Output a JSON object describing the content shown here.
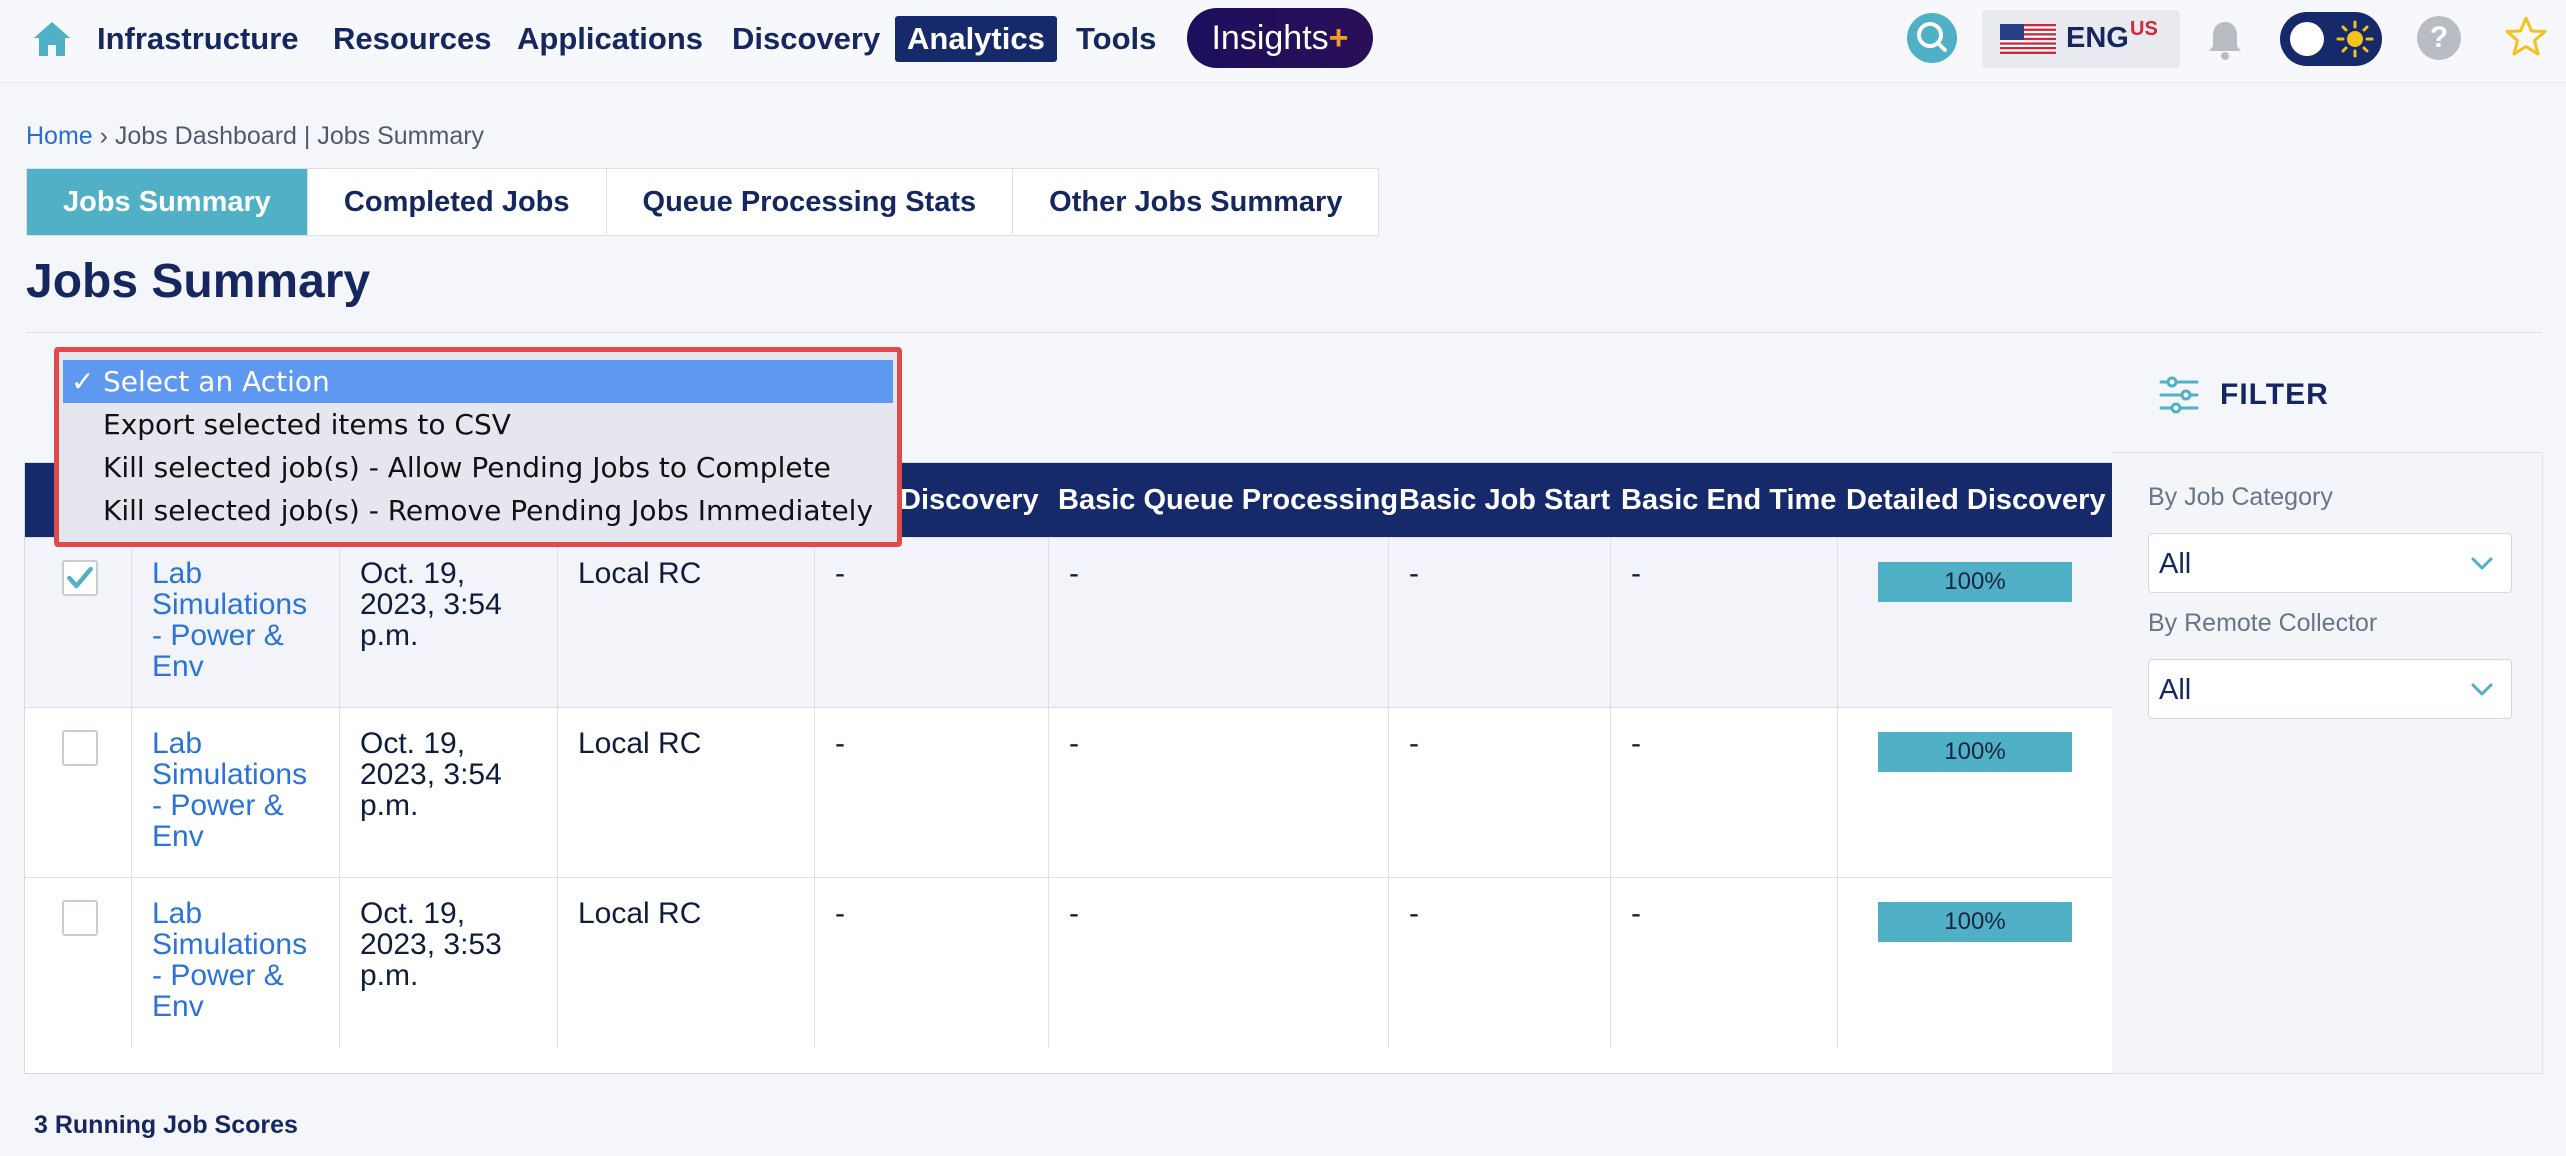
{
  "nav": {
    "items": [
      "Infrastructure",
      "Resources",
      "Applications",
      "Discovery",
      "Analytics",
      "Tools"
    ],
    "active": "Analytics",
    "insights": "Insights",
    "insights_plus": "+",
    "lang": "ENG",
    "lang_region": "US",
    "help": "?"
  },
  "breadcrumb": {
    "home": "Home",
    "sep": " › ",
    "rest": "Jobs Dashboard | Jobs Summary"
  },
  "tabs": [
    "Jobs Summary",
    "Completed Jobs",
    "Queue Processing Stats",
    "Other Jobs Summary"
  ],
  "page_title": "Jobs Summary",
  "action_menu": {
    "options": [
      "Select an Action",
      "Export selected items to CSV",
      "Kill selected job(s) - Allow Pending Jobs to Complete",
      "Kill selected job(s) - Remove Pending Jobs Immediately"
    ],
    "selected_check": "✓"
  },
  "table": {
    "headers": [
      "Discovery",
      "Basic Queue Processing",
      "Basic Job Start",
      "Basic End Time",
      "Detailed Discovery"
    ],
    "rows": [
      {
        "checked": true,
        "job": "Lab Simulations - Power & Env",
        "time": "Oct. 19, 2023, 3:54 p.m.",
        "collector": "Local RC",
        "discovery": "-",
        "queue": "-",
        "start": "-",
        "end": "-",
        "detailed": "100%"
      },
      {
        "checked": false,
        "job": "Lab Simulations - Power & Env",
        "time": "Oct. 19, 2023, 3:54 p.m.",
        "collector": "Local RC",
        "discovery": "-",
        "queue": "-",
        "start": "-",
        "end": "-",
        "detailed": "100%"
      },
      {
        "checked": false,
        "job": "Lab Simulations - Power & Env",
        "time": "Oct. 19, 2023, 3:53 p.m.",
        "collector": "Local RC",
        "discovery": "-",
        "queue": "-",
        "start": "-",
        "end": "-",
        "detailed": "100%"
      }
    ]
  },
  "filter": {
    "title": "FILTER",
    "category_label": "By Job Category",
    "category_value": "All",
    "collector_label": "By Remote Collector",
    "collector_value": "All"
  },
  "footer": {
    "count_text": "3 Running Job Scores"
  },
  "colors": {
    "navy": "#16296a",
    "teal": "#4fb0c6",
    "link": "#2a73d8",
    "highlight": "#e04a4a"
  }
}
